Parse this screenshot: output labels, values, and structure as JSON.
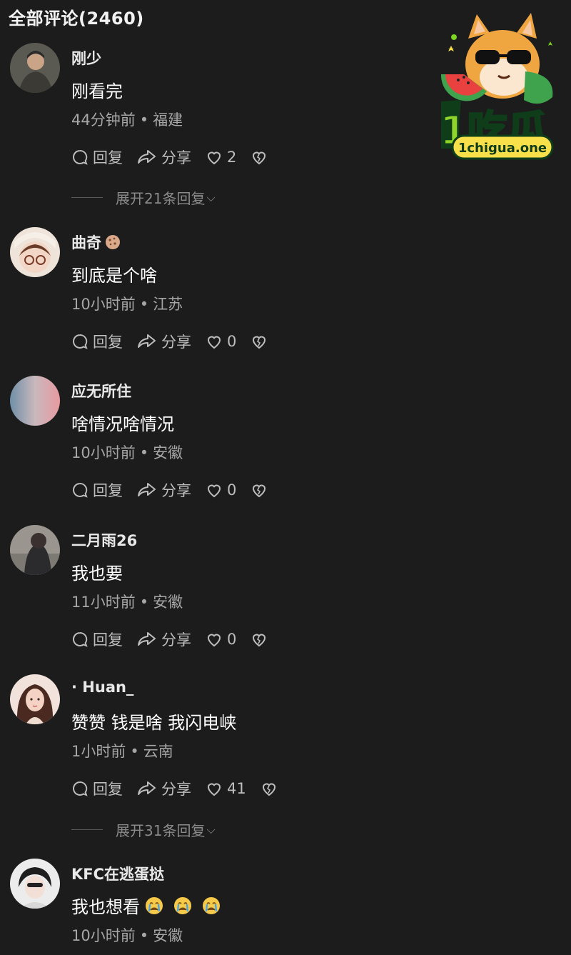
{
  "header": {
    "title": "全部评论(2460)"
  },
  "watermark": {
    "brand": "1吃瓜",
    "url": "1chigua.one"
  },
  "actions": {
    "reply": "回复",
    "share": "分享"
  },
  "comments": [
    {
      "username": "刚少",
      "text": "刚看完",
      "time": "44分钟前",
      "location": "福建",
      "likes": "2",
      "expand": "展开21条回复"
    },
    {
      "username": "曲奇",
      "text": "到底是个啥",
      "time": "10小时前",
      "location": "江苏",
      "likes": "0"
    },
    {
      "username": "应无所住",
      "text": "啥情况啥情况",
      "time": "10小时前",
      "location": "安徽",
      "likes": "0"
    },
    {
      "username": "二月雨26",
      "text": "我也要",
      "time": "11小时前",
      "location": "安徽",
      "likes": "0"
    },
    {
      "username": "· Huan_",
      "text": "赞赞 钱是啥 我闪电峡",
      "time": "1小时前",
      "location": "云南",
      "likes": "41",
      "expand": "展开31条回复"
    },
    {
      "username": "KFC在逃蛋挞",
      "text": "我也想看",
      "time": "10小时前",
      "location": "安徽"
    }
  ],
  "colors": {
    "background": "#1c1c1c",
    "meta": "#a6a6a6",
    "logo_green": "#7ed321"
  }
}
